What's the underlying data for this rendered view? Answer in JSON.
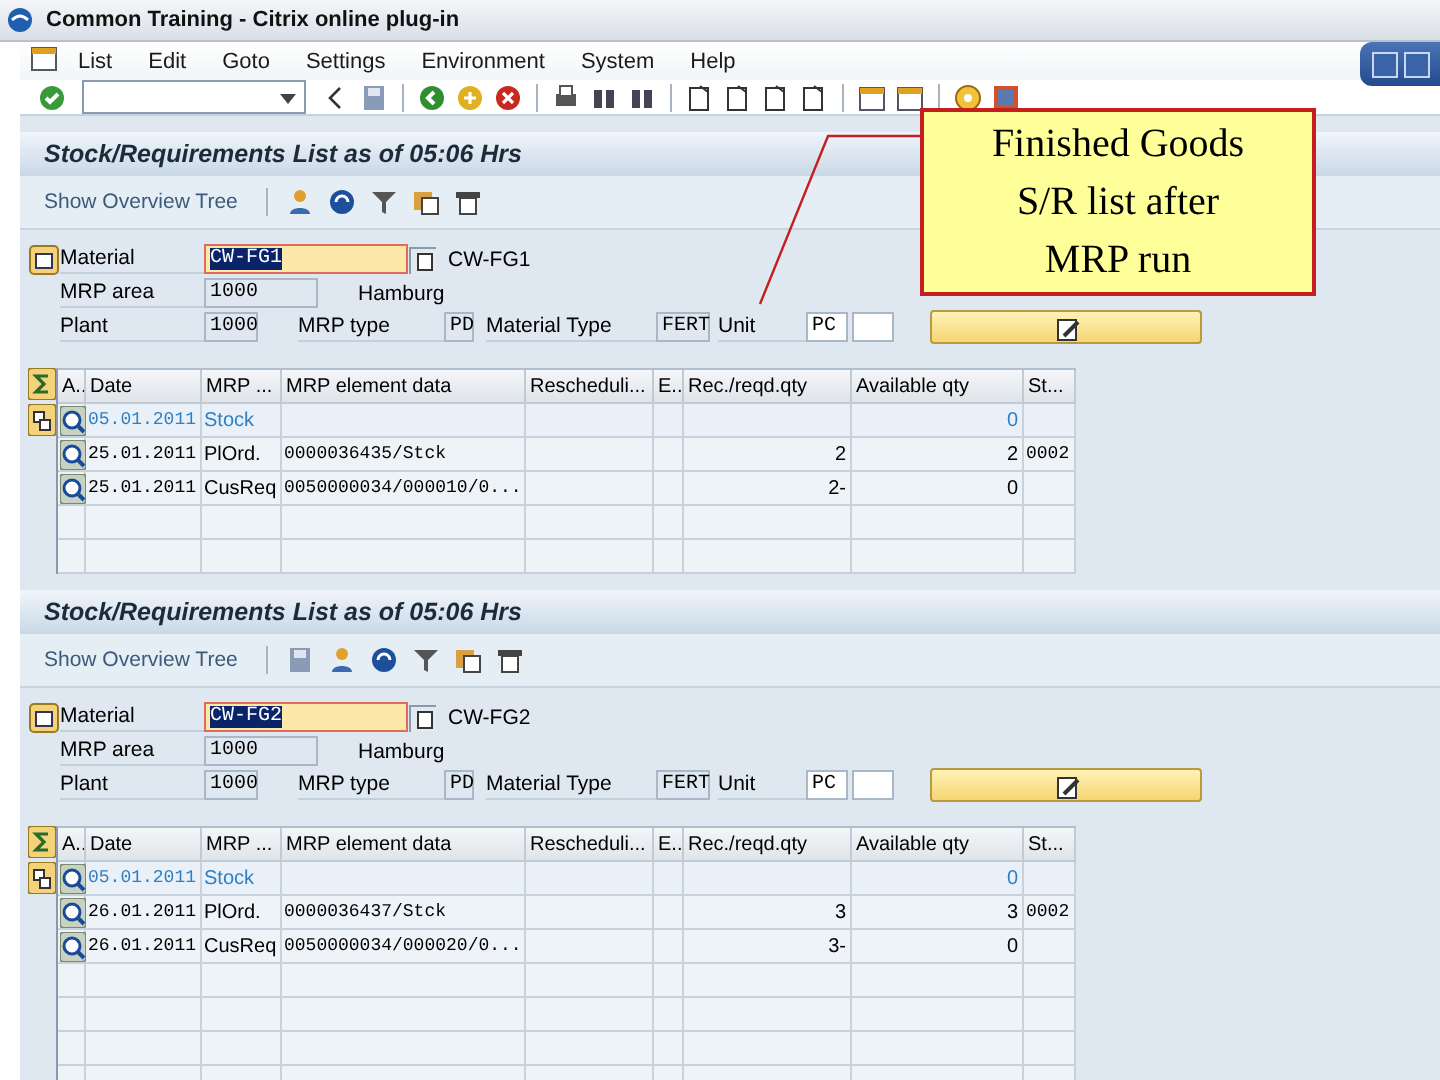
{
  "window": {
    "title": "Common Training - Citrix online plug-in"
  },
  "menu": [
    "List",
    "Edit",
    "Goto",
    "Settings",
    "Environment",
    "System",
    "Help"
  ],
  "sections": [
    {
      "title": "Stock/Requirements List as of 05:06 Hrs",
      "overview_button": "Show Overview Tree",
      "toolbar": [
        {
          "kind": "person"
        },
        {
          "kind": "refresh"
        },
        {
          "kind": "filter"
        },
        {
          "kind": "layout"
        },
        {
          "kind": "table"
        }
      ],
      "material": {
        "label": "Material",
        "value": "CW-FG1",
        "description": "CW-FG1"
      },
      "mrp_area": {
        "label": "MRP area",
        "value": "1000",
        "description": "Hamburg"
      },
      "plant": {
        "label": "Plant",
        "value": "1000"
      },
      "mrp_type": {
        "label": "MRP type",
        "value": "PD"
      },
      "material_type": {
        "label": "Material Type",
        "value": "FERT"
      },
      "unit": {
        "label": "Unit",
        "value": "PC"
      },
      "table": {
        "columns": [
          "A..",
          "Date",
          "MRP ...",
          "MRP element data",
          "Rescheduli...",
          "E..",
          "Rec./reqd.qty",
          "Available qty",
          "St..."
        ],
        "rows": [
          {
            "kind": "stock",
            "date": "05.01.2011",
            "mrp_element": "Stock",
            "available_qty": "0"
          },
          {
            "kind": "element",
            "date": "25.01.2011",
            "mrp_element": "PlOrd.",
            "element_data": "0000036435/Stck",
            "rec_reqd_qty": "2",
            "available_qty": "2",
            "st": "0002"
          },
          {
            "kind": "element",
            "date": "25.01.2011",
            "mrp_element": "CusReq",
            "element_data": "0050000034/000010/0...",
            "rec_reqd_qty": "2-",
            "available_qty": "0"
          }
        ]
      }
    },
    {
      "title": "Stock/Requirements List as of 05:06 Hrs",
      "overview_button": "Show Overview Tree",
      "toolbar": [
        {
          "kind": "save"
        },
        {
          "kind": "person"
        },
        {
          "kind": "refresh"
        },
        {
          "kind": "filter"
        },
        {
          "kind": "layout"
        },
        {
          "kind": "table"
        }
      ],
      "material": {
        "label": "Material",
        "value": "CW-FG2",
        "description": "CW-FG2"
      },
      "mrp_area": {
        "label": "MRP area",
        "value": "1000",
        "description": "Hamburg"
      },
      "plant": {
        "label": "Plant",
        "value": "1000"
      },
      "mrp_type": {
        "label": "MRP type",
        "value": "PD"
      },
      "material_type": {
        "label": "Material Type",
        "value": "FERT"
      },
      "unit": {
        "label": "Unit",
        "value": "PC"
      },
      "table": {
        "columns": [
          "A..",
          "Date",
          "MRP ...",
          "MRP element data",
          "Rescheduli...",
          "E..",
          "Rec./reqd.qty",
          "Available qty",
          "St..."
        ],
        "rows": [
          {
            "kind": "stock",
            "date": "05.01.2011",
            "mrp_element": "Stock",
            "available_qty": "0"
          },
          {
            "kind": "element",
            "date": "26.01.2011",
            "mrp_element": "PlOrd.",
            "element_data": "0000036437/Stck",
            "rec_reqd_qty": "3",
            "available_qty": "3",
            "st": "0002"
          },
          {
            "kind": "element",
            "date": "26.01.2011",
            "mrp_element": "CusReq",
            "element_data": "0050000034/000020/0...",
            "rec_reqd_qty": "3-",
            "available_qty": "0"
          }
        ]
      }
    }
  ],
  "callout": {
    "lines": [
      "Finished Goods",
      "S/R list after",
      "MRP run"
    ]
  }
}
